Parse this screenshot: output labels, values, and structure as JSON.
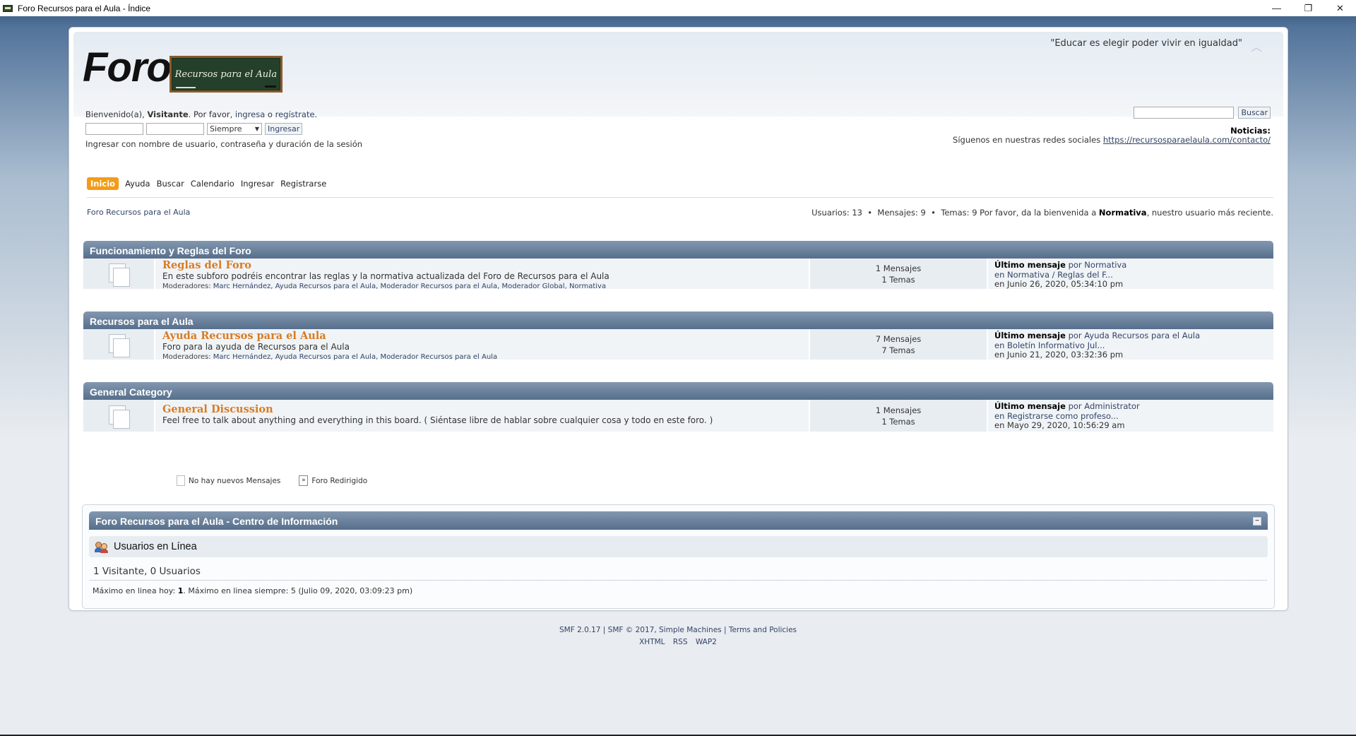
{
  "window": {
    "title": "Foro Recursos para el Aula - Índice",
    "minimize": "—",
    "restore": "❐",
    "close": "✕"
  },
  "header": {
    "slogan": "\"Educar es elegir poder vivir en igualdad\"",
    "logo_text": "Foro",
    "logo_board_text": "Recursos para el Aula"
  },
  "login": {
    "greeting_prefix": "Bienvenido(a), ",
    "greeting_user": "Visitante",
    "greeting_middle": ". Por favor, ",
    "login_link": "ingresa",
    "greeting_or": " o ",
    "register_link": "regístrate",
    "greeting_end": ".",
    "duration_value": "Siempre",
    "submit_label": "Ingresar",
    "hint": "Ingresar con nombre de usuario, contraseña y duración de la sesión"
  },
  "search": {
    "button": "Buscar",
    "value": ""
  },
  "news": {
    "label": "Noticias:",
    "text": "Síguenos en nuestras redes sociales ",
    "link": "https://recursosparaelaula.com/contacto/"
  },
  "menu": {
    "items": [
      {
        "label": "Inicio",
        "active": true
      },
      {
        "label": "Ayuda"
      },
      {
        "label": "Buscar"
      },
      {
        "label": "Calendario"
      },
      {
        "label": "Ingresar"
      },
      {
        "label": "Registrarse"
      }
    ]
  },
  "breadcrumb": "Foro Recursos para el Aula",
  "stats": {
    "users_label": "Usuarios: ",
    "users": "13",
    "posts_label": "Mensajes: ",
    "posts": "9",
    "topics_label": "Temas: ",
    "topics": "9",
    "welcome_prefix": " Por favor, da la bienvenida a ",
    "newest_member": "Normativa",
    "welcome_suffix": ", nuestro usuario más reciente."
  },
  "categories": [
    {
      "title": "Funcionamiento y Reglas del Foro",
      "board": {
        "name": "Reglas del Foro",
        "description": "En este subforo podréis encontrar las reglas y la normativa actualizada del Foro de Recursos para el Aula",
        "moderators_label": "Moderadores: ",
        "moderators": "Marc Hernández, Ayuda Recursos para el Aula, Moderador Recursos para el Aula, Moderador Global, Normativa",
        "posts": "1 Mensajes",
        "topics": "1 Temas",
        "last_label": "Último mensaje",
        "last_by": " por Normativa",
        "last_in": "en Normativa / Reglas del F...",
        "last_date": "en Junio 26, 2020, 05:34:10 pm"
      }
    },
    {
      "title": "Recursos para el Aula",
      "board": {
        "name": "Ayuda Recursos para el Aula",
        "description": "Foro para la ayuda de Recursos para el Aula",
        "moderators_label": "Moderadores: ",
        "moderators": "Marc Hernández, Ayuda Recursos para el Aula, Moderador Recursos para el Aula",
        "posts": "7 Mensajes",
        "topics": "7 Temas",
        "last_label": "Último mensaje",
        "last_by": " por Ayuda Recursos para el Aula",
        "last_in": "en Boletín Informativo Jul...",
        "last_date": "en Junio 21, 2020, 03:32:36 pm"
      }
    },
    {
      "title": "General Category",
      "board": {
        "name": "General Discussion",
        "description": "Feel free to talk about anything and everything in this board. ( Siéntase libre de hablar sobre cualquier cosa y todo en este foro. )",
        "moderators_label": "",
        "moderators": "",
        "posts": "1 Mensajes",
        "topics": "1 Temas",
        "last_label": "Último mensaje",
        "last_by": " por Administrator",
        "last_in": "en Registrarse como profeso...",
        "last_date": "en Mayo 29, 2020, 10:56:29 am"
      }
    }
  ],
  "legend": {
    "no_new": "No hay nuevos Mensajes",
    "redirect": "Foro Redirigido",
    "redirect_glyph": "»"
  },
  "info_center": {
    "title": "Foro Recursos para el Aula - Centro de Información",
    "toggle": "−",
    "online_title": "Usuarios en Línea",
    "online_count": "1 Visitante, 0 Usuarios",
    "max_today_label": "Máximo en linea hoy: ",
    "max_today": "1",
    "max_ever": ". Máximo en linea siempre: 5 (Julio 09, 2020, 03:09:23 pm)"
  },
  "footer": {
    "line1": "SMF 2.0.17 | SMF © 2017, Simple Machines | Terms and Policies",
    "links": [
      "XHTML",
      "RSS",
      "WAP2"
    ]
  },
  "colors": {
    "accent": "#f39c1a",
    "board_name": "#d97b24",
    "cat_header": "#566f8c"
  }
}
